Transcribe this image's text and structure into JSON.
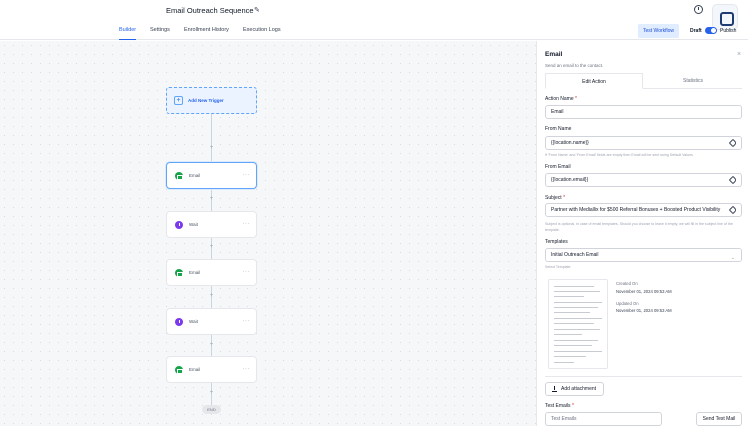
{
  "header": {
    "workflow_title": "Email Outreach Sequence",
    "edit_icon": "pencil-icon",
    "history_icon": "clock-icon"
  },
  "tabs": [
    {
      "label": "Builder",
      "active": true
    },
    {
      "label": "Settings"
    },
    {
      "label": "Enrollment History"
    },
    {
      "label": "Execution Logs"
    }
  ],
  "toolbar": {
    "test_label": "Test Workflow",
    "draft_label": "Draft",
    "publish_label": "Publish",
    "toggle_on": true
  },
  "canvas": {
    "trigger_label": "Add New Trigger",
    "nodes": [
      {
        "type": "email",
        "label": "Email",
        "icon": "email-icon"
      },
      {
        "type": "wait",
        "label": "Wait",
        "icon": "wait-icon"
      },
      {
        "type": "email",
        "label": "Email",
        "icon": "email-icon"
      },
      {
        "type": "wait",
        "label": "Wait",
        "icon": "wait-icon"
      },
      {
        "type": "email",
        "label": "Email",
        "icon": "email-icon"
      }
    ],
    "node_menu": "···",
    "add_symbol": "+",
    "end_label": "END"
  },
  "panel": {
    "title": "Email",
    "description": "Send an email to the contact.",
    "tabs": [
      "Edit Action",
      "Statistics"
    ],
    "action_name_label": "Action Name",
    "action_name_value": "Email",
    "from_name_label": "From Name",
    "from_name_value": "{{location.name}}",
    "from_name_hint": "If 'From Name' and 'From Email' fields are empty then Email will be sent using Default Values",
    "from_email_label": "From Email",
    "from_email_value": "{{location.email}}",
    "subject_label": "Subject",
    "subject_value": "Partner with Mediallix for $500 Referral Bonuses + Boosted Product Visibility",
    "subject_hint": "Subject is optional, in case of email templates. Should you choose to leave it empty, we will fill in the subject line of the template.",
    "templates_label": "Templates",
    "template_value": "Initial Outreach Email",
    "template_hint": "Select Template",
    "created_on_label": "Created On",
    "created_on_value": "November 01, 2024 09:53 AM",
    "updated_on_label": "Updated On",
    "updated_on_value": "November 01, 2024 09:53 AM",
    "attachment_label": "Add attachment",
    "test_emails_label": "Test Emails",
    "test_emails_placeholder": "Test Emails",
    "send_test_label": "Send Test Mail",
    "required_mark": "*",
    "close_symbol": "×"
  }
}
